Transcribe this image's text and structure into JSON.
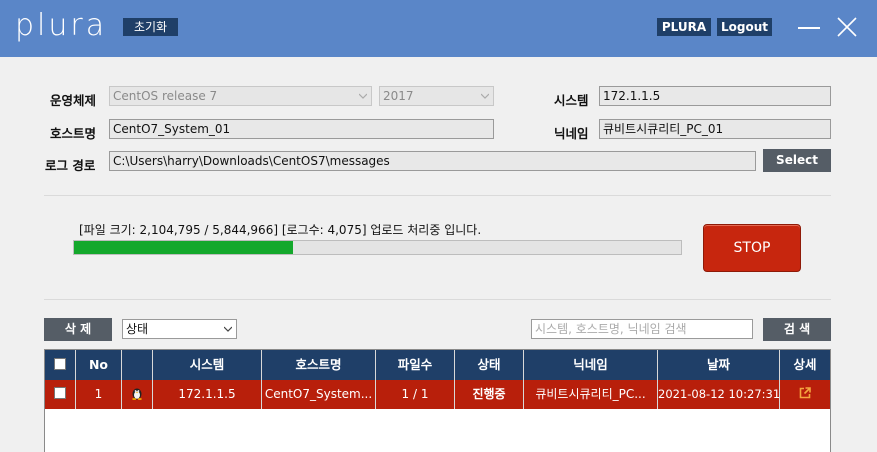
{
  "header": {
    "logo": "PLURA",
    "reset_label": "초기화",
    "plura_label": "PLURA",
    "logout_label": "Logout"
  },
  "form": {
    "os_label": "운영체제",
    "os_value": "CentOS release 7",
    "version_value": "2017",
    "system_label": "시스템",
    "system_value": "172.1.1.5",
    "hostname_label": "호스트명",
    "hostname_value": "CentO7_System_01",
    "nickname_label": "닉네임",
    "nickname_value": "큐비트시큐리티_PC_01",
    "logpath_label": "로그 경로",
    "logpath_value": "C:\\Users\\harry\\Downloads\\CentOS7\\messages",
    "select_label": "Select"
  },
  "progress": {
    "status_text": "[파일 크기: 2,104,795 / 5,844,966] [로그수: 4,075]  업로드 처리중 입니다.",
    "fraction": 0.36,
    "stop_label": "STOP"
  },
  "toolbar": {
    "delete_label": "삭 제",
    "status_select_value": "상태",
    "search_placeholder": "시스템, 호스트명, 닉네임 검색",
    "search_label": "검 색"
  },
  "table": {
    "headers": {
      "no": "No",
      "system": "시스템",
      "hostname": "호스트명",
      "files": "파일수",
      "status": "상태",
      "nickname": "닉네임",
      "date": "날짜",
      "detail": "상세"
    },
    "rows": [
      {
        "no": "1",
        "system": "172.1.1.5",
        "hostname": "CentO7_System...",
        "files": "1 / 1",
        "status": "진행중",
        "nickname": "큐비트시큐리티_PC...",
        "date": "2021-08-12 10:27:31"
      }
    ]
  },
  "icons": {
    "os_icon": "linux-penguin-icon",
    "detail_icon": "external-link-icon"
  },
  "colors": {
    "header_bg": "#5a86c8",
    "table_header_bg": "#1f3f68",
    "active_row_bg": "#b81f0b",
    "progress_fill": "#14a82c",
    "stop_bg": "#c7260e"
  }
}
